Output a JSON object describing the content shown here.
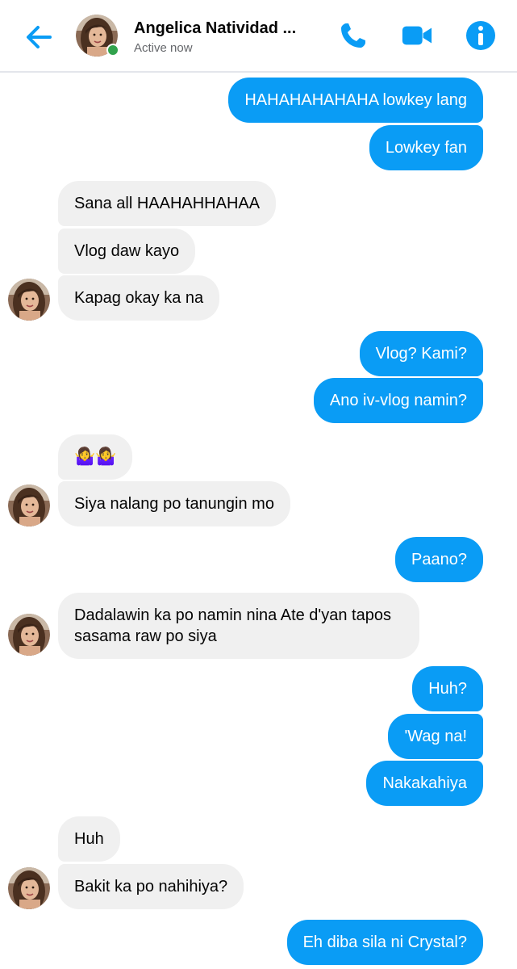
{
  "header": {
    "contact_name": "Angelica Natividad ...",
    "status": "Active now",
    "icons": {
      "back": "arrow-left-icon",
      "call": "phone-icon",
      "video": "video-camera-icon",
      "info": "info-icon"
    },
    "accent_color": "#0a9cf5",
    "online_color": "#31a24c"
  },
  "messages": [
    {
      "direction": "out",
      "text": "HAHAHAHAHAHA lowkey lang"
    },
    {
      "direction": "out",
      "text": "Lowkey fan"
    },
    {
      "direction": "in",
      "text": "Sana all HAAHAHHAHAA"
    },
    {
      "direction": "in",
      "text": "Vlog daw kayo"
    },
    {
      "direction": "in",
      "text": "Kapag okay ka na"
    },
    {
      "direction": "out",
      "text": "Vlog? Kami?"
    },
    {
      "direction": "out",
      "text": "Ano iv-vlog namin?"
    },
    {
      "direction": "in",
      "text": "🤷‍♀️🤷‍♀️"
    },
    {
      "direction": "in",
      "text": "Siya nalang po tanungin mo"
    },
    {
      "direction": "out",
      "text": "Paano?"
    },
    {
      "direction": "in",
      "text": "Dadalawin ka po namin nina Ate d'yan tapos sasama raw po siya"
    },
    {
      "direction": "out",
      "text": "Huh?"
    },
    {
      "direction": "out",
      "text": "'Wag na!"
    },
    {
      "direction": "out",
      "text": "Nakakahiya"
    },
    {
      "direction": "in",
      "text": "Huh"
    },
    {
      "direction": "in",
      "text": "Bakit ka po nahihiya?"
    },
    {
      "direction": "out",
      "text": "Eh diba sila ni Crystal?"
    }
  ]
}
